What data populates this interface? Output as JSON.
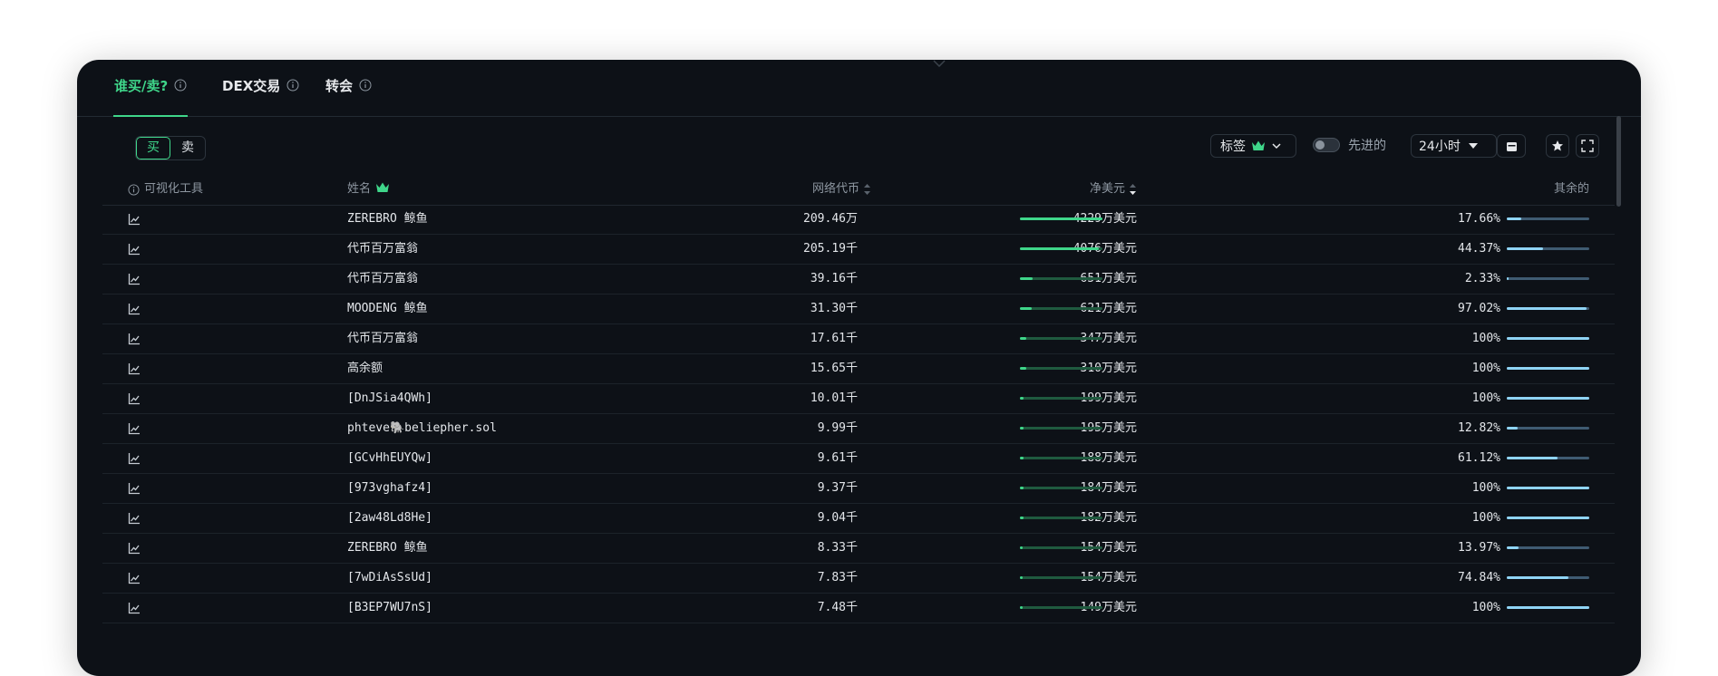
{
  "tabs": [
    {
      "label": "谁买/卖?",
      "active": true
    },
    {
      "label": "DEX交易",
      "active": false
    },
    {
      "label": "转会",
      "active": false
    }
  ],
  "side_toggle": {
    "buy": "买",
    "sell": "卖",
    "selected": "买"
  },
  "filters": {
    "tags_label": "标签",
    "advanced_label": "先进的",
    "advanced_on": false,
    "timeframe": "24小时"
  },
  "columns": {
    "visual": "可视化工具",
    "name": "姓名",
    "tokens": "网络代币",
    "net_usd": "净美元",
    "remaining": "其余的"
  },
  "colors": {
    "accent": "#3fd68a",
    "background": "#0d1117",
    "remaining_bar": "#8fd4f5"
  },
  "rows": [
    {
      "name": "ZEREBRO 鲸鱼",
      "tokens": "209.46万",
      "usd": "4229万美元",
      "usd_fill": 1.0,
      "remaining": "17.66%",
      "rem_fill": 0.1766
    },
    {
      "name": "代币百万富翁",
      "tokens": "205.19千",
      "usd": "4076万美元",
      "usd_fill": 0.96,
      "remaining": "44.37%",
      "rem_fill": 0.4437
    },
    {
      "name": "代币百万富翁",
      "tokens": "39.16千",
      "usd": "651万美元",
      "usd_fill": 0.15,
      "remaining": "2.33%",
      "rem_fill": 0.0233
    },
    {
      "name": "MOODENG 鲸鱼",
      "tokens": "31.30千",
      "usd": "621万美元",
      "usd_fill": 0.147,
      "remaining": "97.02%",
      "rem_fill": 0.9702
    },
    {
      "name": "代币百万富翁",
      "tokens": "17.61千",
      "usd": "347万美元",
      "usd_fill": 0.082,
      "remaining": "100%",
      "rem_fill": 1.0
    },
    {
      "name": "高余额",
      "tokens": "15.65千",
      "usd": "310万美元",
      "usd_fill": 0.073,
      "remaining": "100%",
      "rem_fill": 1.0
    },
    {
      "name": "[DnJSia4QWh]",
      "tokens": "10.01千",
      "usd": "199万美元",
      "usd_fill": 0.047,
      "remaining": "100%",
      "rem_fill": 1.0
    },
    {
      "name": "phteve🐘beliepher.sol",
      "tokens": "9.99千",
      "usd": "195万美元",
      "usd_fill": 0.046,
      "remaining": "12.82%",
      "rem_fill": 0.1282
    },
    {
      "name": "[GCvHhEUYQw]",
      "tokens": "9.61千",
      "usd": "188万美元",
      "usd_fill": 0.044,
      "remaining": "61.12%",
      "rem_fill": 0.6112
    },
    {
      "name": "[973vghafz4]",
      "tokens": "9.37千",
      "usd": "184万美元",
      "usd_fill": 0.043,
      "remaining": "100%",
      "rem_fill": 1.0
    },
    {
      "name": "[2aw48Ld8He]",
      "tokens": "9.04千",
      "usd": "182万美元",
      "usd_fill": 0.043,
      "remaining": "100%",
      "rem_fill": 1.0
    },
    {
      "name": "ZEREBRO 鲸鱼",
      "tokens": "8.33千",
      "usd": "154万美元",
      "usd_fill": 0.036,
      "remaining": "13.97%",
      "rem_fill": 0.1397
    },
    {
      "name": "[7wDiAsSsUd]",
      "tokens": "7.83千",
      "usd": "154万美元",
      "usd_fill": 0.036,
      "remaining": "74.84%",
      "rem_fill": 0.7484
    },
    {
      "name": "[B3EP7WU7nS]",
      "tokens": "7.48千",
      "usd": "149万美元",
      "usd_fill": 0.035,
      "remaining": "100%",
      "rem_fill": 1.0
    }
  ]
}
